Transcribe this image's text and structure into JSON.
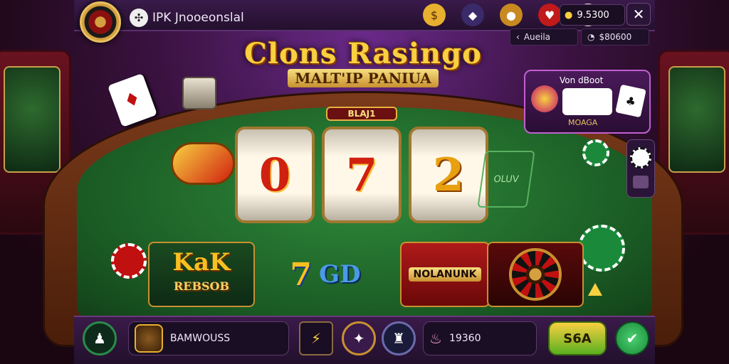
{
  "header": {
    "brand": "IPK Jnooeonslal",
    "balance": "9.5300",
    "sub_left": "Aueila",
    "sub_right": "$80600",
    "icons": [
      "coins-icon",
      "gem-icon",
      "money-bag-icon",
      "gift-icon",
      "cards-icon"
    ]
  },
  "title": {
    "line1": "Clons Rasingo",
    "line2": "MALT'IP PANIUA"
  },
  "reels": {
    "label": "BLAJ1",
    "symbols": [
      "0",
      "7",
      "2"
    ],
    "side_text": "OLUV"
  },
  "promo": {
    "header": "Von dBoot",
    "footer": "MOAGA"
  },
  "games": [
    {
      "title": "KaK",
      "sub": "REBSOB"
    },
    {
      "title": "7",
      "sub": "GD"
    },
    {
      "title": "NOLANUNK"
    },
    {
      "title": ""
    }
  ],
  "footer": {
    "name_field": "BAMWOUSS",
    "amount": "19360",
    "bet_label": "S6A"
  },
  "colors": {
    "felt": "#2f8a3a",
    "gold": "#f8d040",
    "panel": "#3a1a4a"
  }
}
